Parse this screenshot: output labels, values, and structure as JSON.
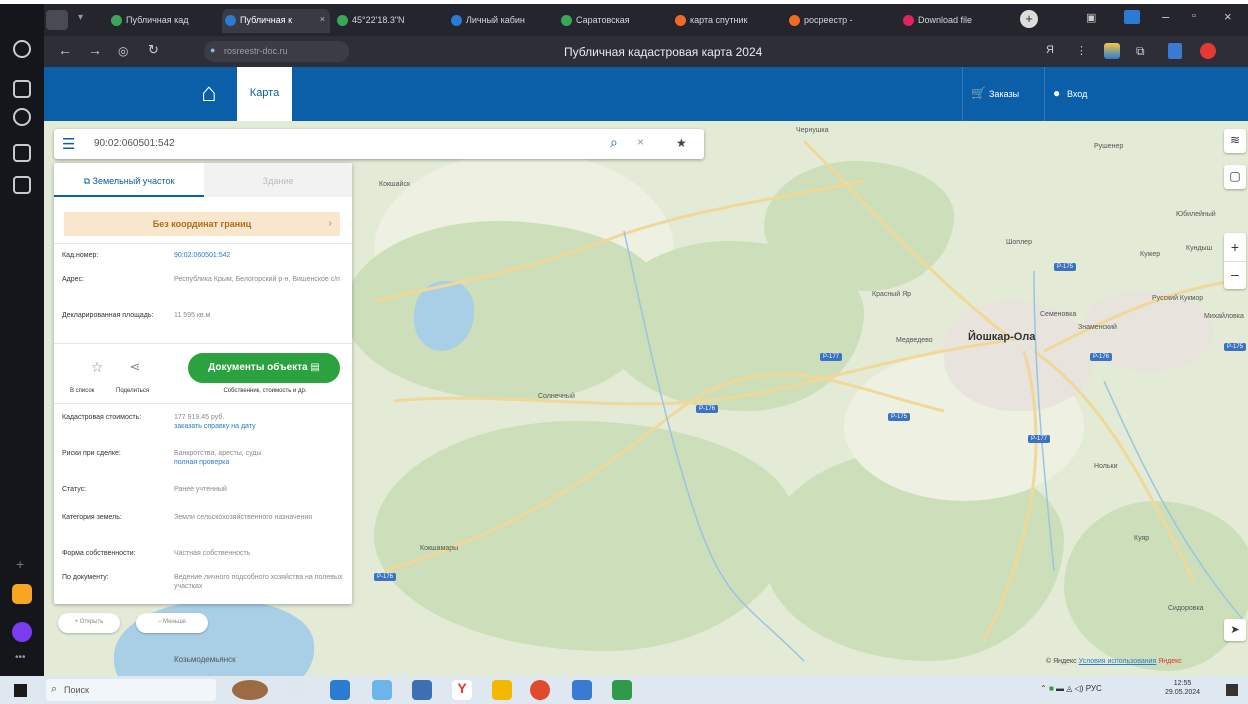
{
  "browser": {
    "tabs": [
      {
        "label": "Публичная кад",
        "color": "#3aa757"
      },
      {
        "label": "Публичная к",
        "color": "#2a7bd1",
        "active": true
      },
      {
        "label": "45°22'18.3\"N",
        "color": "#3aa757"
      },
      {
        "label": "Личный кабин",
        "color": "#2a7bd1"
      },
      {
        "label": "Саратовская",
        "color": "#3aa757"
      },
      {
        "label": "карта спутник",
        "color": "#f26b21"
      },
      {
        "label": "росреестр -",
        "color": "#f26b21"
      },
      {
        "label": "Download file",
        "color": "#e0245e"
      }
    ],
    "address": "rosreestr-doc.ru",
    "page_title": "Публичная кадастровая карта 2024"
  },
  "header": {
    "tab_map": "Карта",
    "orders": "Заказы",
    "login": "Вход",
    "brand_color": "#0b5ea8"
  },
  "search": {
    "query": "90:02:060501:542"
  },
  "panel": {
    "tab_land": "Земельный участок",
    "tab_building": "Здание",
    "no_bounds": "Без координат границ",
    "fields": [
      {
        "label": "Кад.номер:",
        "value": "90:02:060501:542"
      },
      {
        "label": "Адрес:",
        "value": "Республика Крым, Белогорский р-н, Вишенское с/п"
      },
      {
        "label": "Декларированная площадь:",
        "value": "11 595 кв.м"
      }
    ],
    "fav_label": "В список",
    "share_label": "Поделиться",
    "docs_button": "Документы объекта",
    "docs_sub": "Собственник, стоимость и др.",
    "details": [
      {
        "label": "Кадастровая стоимость:",
        "value": "177 919.45 руб.",
        "link": "заказать справку на дату"
      },
      {
        "label": "Риски при сделке:",
        "value": "Банкротства, аресты, суды",
        "link": "полная проверка"
      },
      {
        "label": "Статус:",
        "value": "Ранее учтенный"
      },
      {
        "label": "Категория земель:",
        "value": "Земли сельскохозяйственного назначения"
      },
      {
        "label": "Форма собственности:",
        "value": "Частная собственность"
      },
      {
        "label": "По документу:",
        "value": "Ведение личного подсобного хозяйства на полевых участках"
      }
    ]
  },
  "pills": {
    "open": "Открыть",
    "less": "Меньше"
  },
  "map": {
    "labels": [
      {
        "text": "Йошкар-Ола",
        "big": true
      },
      {
        "text": "Медведево"
      },
      {
        "text": "Кокшайск"
      },
      {
        "text": "Семеновка"
      },
      {
        "text": "Знаменский"
      },
      {
        "text": "Шоплер"
      },
      {
        "text": "Кужер"
      },
      {
        "text": "Русский Кукмор"
      },
      {
        "text": "Михайловка"
      },
      {
        "text": "Кундыш"
      },
      {
        "text": "Нольки"
      },
      {
        "text": "Сидоровка"
      },
      {
        "text": "Чернушка"
      },
      {
        "text": "Красный Яр"
      },
      {
        "text": "Рушенер"
      },
      {
        "text": "Куяр"
      },
      {
        "text": "Солнечный"
      },
      {
        "text": "Юбилейный"
      },
      {
        "text": "Кокшамары"
      },
      {
        "text": "Козьмодемьянск"
      }
    ],
    "shields": [
      "Р-177",
      "Р-176",
      "Р-175",
      "Р-175",
      "Р-176",
      "Р-177",
      "Р-176",
      "Р-175"
    ],
    "copyright": "© Яндекс",
    "terms": "Условия использования",
    "yandex": "Яндекс"
  },
  "taskbar": {
    "search": "Поиск",
    "lang": "РУС",
    "time": "12:55",
    "date": "29.05.2024"
  }
}
